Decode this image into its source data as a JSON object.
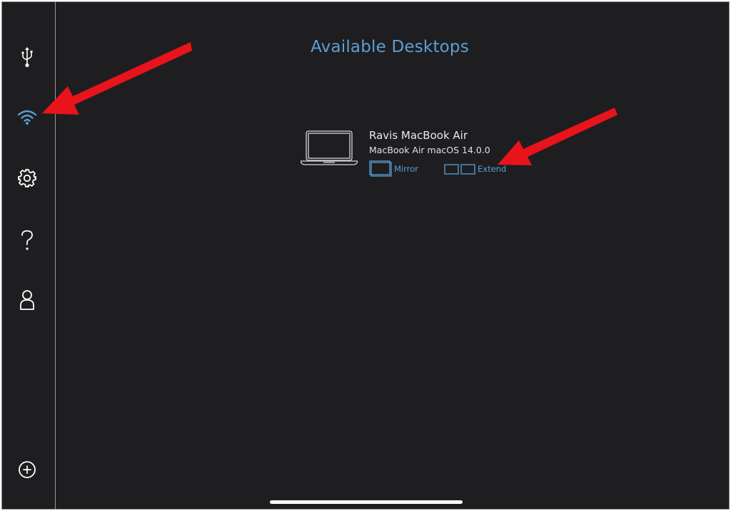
{
  "sidebar": {
    "items": [
      {
        "name": "usb",
        "icon": "usb-icon"
      },
      {
        "name": "wifi",
        "icon": "wifi-icon",
        "selected": true
      },
      {
        "name": "settings",
        "icon": "gear-icon"
      },
      {
        "name": "help",
        "icon": "question-mark-icon"
      },
      {
        "name": "account",
        "icon": "person-icon"
      },
      {
        "name": "add",
        "icon": "plus-circle-icon"
      }
    ]
  },
  "main": {
    "title": "Available Desktops",
    "desktop": {
      "icon": "laptop-icon",
      "name": "Ravis MacBook Air",
      "subtitle": "MacBook Air macOS 14.0.0",
      "mirror_label": "Mirror",
      "extend_label": "Extend"
    }
  },
  "colors": {
    "background": "#1e1e20",
    "accent": "#5b9fd6",
    "annotation_arrow": "#e8131b",
    "icon": "#ffffff"
  }
}
